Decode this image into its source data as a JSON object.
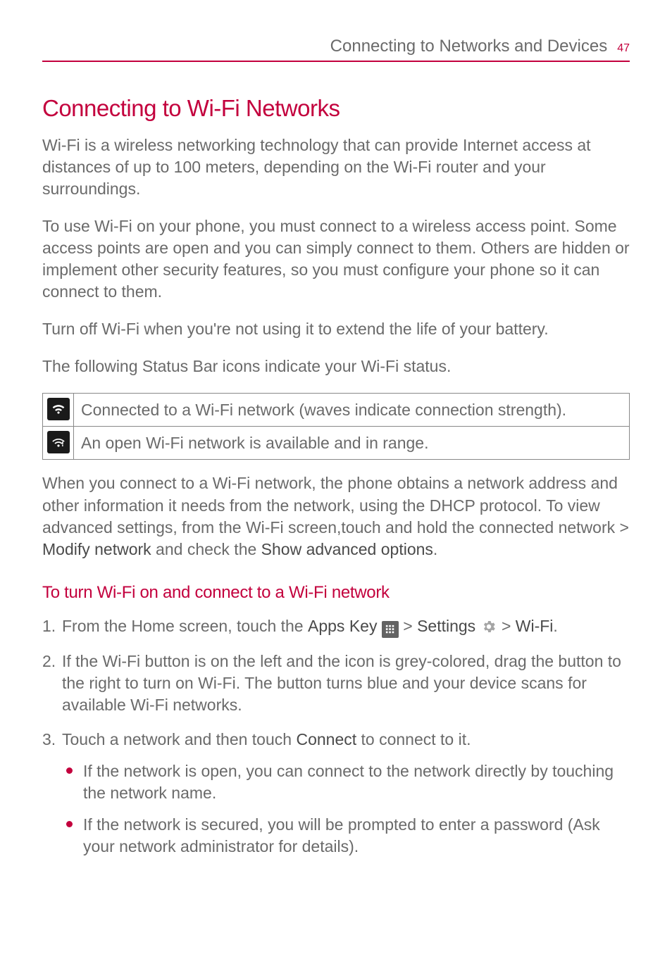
{
  "header": {
    "title": "Connecting to Networks and Devices",
    "page": "47"
  },
  "main": {
    "h1": "Connecting to Wi-Fi Networks",
    "p1": "Wi-Fi is a wireless networking technology that can provide Internet access at distances of up to 100 meters, depending on the Wi-Fi router and your surroundings.",
    "p2": "To use Wi-Fi on your phone, you must connect to a wireless access point. Some access points are open and you can simply connect to them. Others are hidden or implement other security features, so you must configure your phone so it can connect to them.",
    "p3": "Turn off Wi-Fi when you're not using it to extend the life of your battery.",
    "p4": "The following Status Bar icons indicate your Wi-Fi status.",
    "table": {
      "row1": "Connected to a Wi-Fi network (waves indicate connection strength).",
      "row2": "An open Wi-Fi network is available and in range."
    },
    "p5a": "When you connect to a Wi-Fi network, the phone obtains a network address and other information it needs from the network, using the DHCP protocol. To view advanced settings, from the Wi-Fi screen,touch and hold the connected network > ",
    "p5b": "Modify network",
    "p5c": " and check the ",
    "p5d": "Show advanced options",
    "p5e": ".",
    "h2": "To turn Wi-Fi on and connect to a Wi-Fi network",
    "step1": {
      "a": "From the Home screen, touch the ",
      "b": "Apps Key",
      "c": " > ",
      "d": "Settings",
      "e": " > ",
      "f": "Wi-Fi",
      "g": "."
    },
    "step2": "If the Wi-Fi button is on the left and the icon is grey-colored, drag the button to the right to turn on Wi-Fi. The button turns blue and your device scans for available Wi-Fi networks.",
    "step3": {
      "a": "Touch a network and then touch ",
      "b": "Connect",
      "c": " to connect to it.",
      "bullet1": "If the network is open, you can connect to the network directly by touching the network name.",
      "bullet2": "If the network is secured, you will be prompted to enter a password (Ask your network administrator for details)."
    }
  }
}
